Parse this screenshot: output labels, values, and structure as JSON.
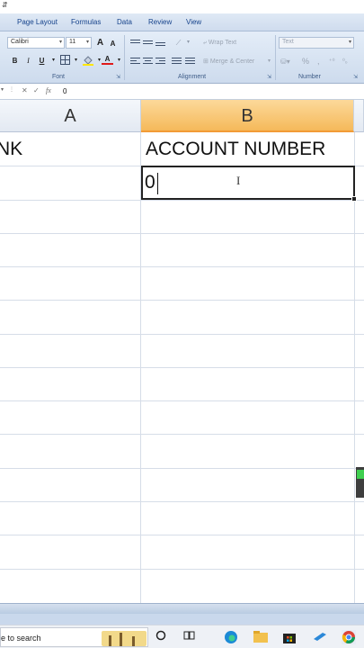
{
  "title_bar": {
    "quick_access": "⇵"
  },
  "ribbon_tabs": [
    "Page Layout",
    "Formulas",
    "Data",
    "Review",
    "View"
  ],
  "ribbon": {
    "font_name": "Calibri",
    "font_size": "11",
    "grow_font": "A",
    "shrink_font": "A",
    "bold": "B",
    "italic": "I",
    "underline": "U",
    "font_color": "A",
    "wrap_text": "Wrap Text",
    "merge_center": "Merge & Center",
    "number_format": "Text",
    "percent": "%",
    "comma": ",",
    "groups": {
      "font": "Font",
      "alignment": "Alignment",
      "number": "Number"
    }
  },
  "formula_bar": {
    "cancel": "✕",
    "enter": "✓",
    "fx": "fx",
    "value": "0"
  },
  "grid": {
    "columns": [
      "A",
      "B"
    ],
    "selected_column": "B",
    "row1": {
      "a": "NK",
      "b": "ACCOUNT NUMBER"
    },
    "active_cell_value": "0"
  },
  "taskbar": {
    "search_placeholder": "e to search"
  },
  "colors": {
    "ribbon": "#dfe9f5",
    "selected_header": "#f5b95a",
    "active_cell_border": "#222222"
  }
}
